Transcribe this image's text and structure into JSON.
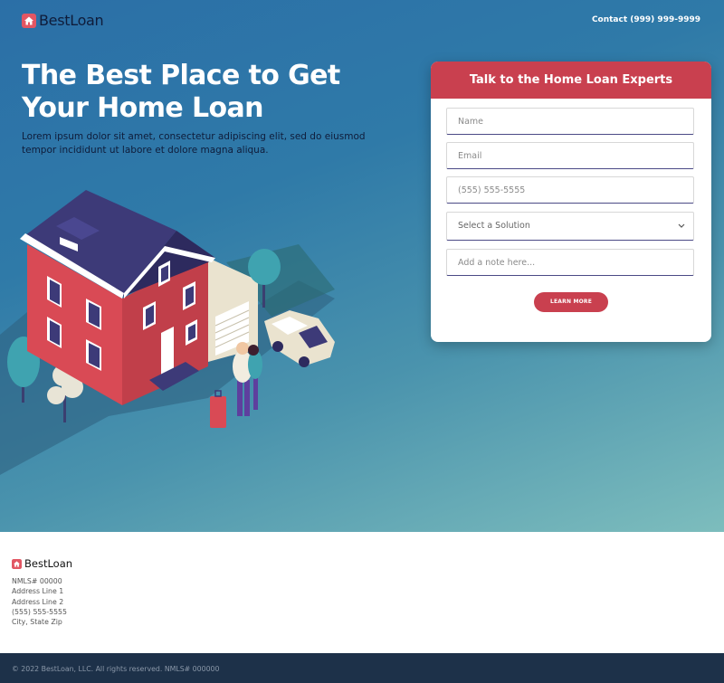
{
  "brand": {
    "name": "BestLoan"
  },
  "header": {
    "contact": "Contact (999) 999-9999"
  },
  "hero": {
    "headline": "The Best Place to Get Your Home Loan",
    "subtext": "Lorem ipsum dolor sit amet, consectetur adipiscing elit, sed do eiusmod tempor incididunt ut labore et dolore magna aliqua."
  },
  "form": {
    "title": "Talk to the Home Loan Experts",
    "name_placeholder": "Name",
    "email_placeholder": "Email",
    "phone_placeholder": "(555) 555-5555",
    "select_value": "Select a Solution",
    "note_placeholder": "Add a note here...",
    "submit_label": "LEARN MORE"
  },
  "footer": {
    "lines": [
      "NMLS# 00000",
      "Address Line 1",
      "Address Line 2",
      "(555) 555-5555",
      "City, State Zip"
    ],
    "copyright": "© 2022 BestLoan, LLC. All rights reserved. NMLS# 000000"
  },
  "colors": {
    "accent": "#c9404f",
    "navy": "#0f1c3a",
    "footer_bar": "#1d3149"
  }
}
